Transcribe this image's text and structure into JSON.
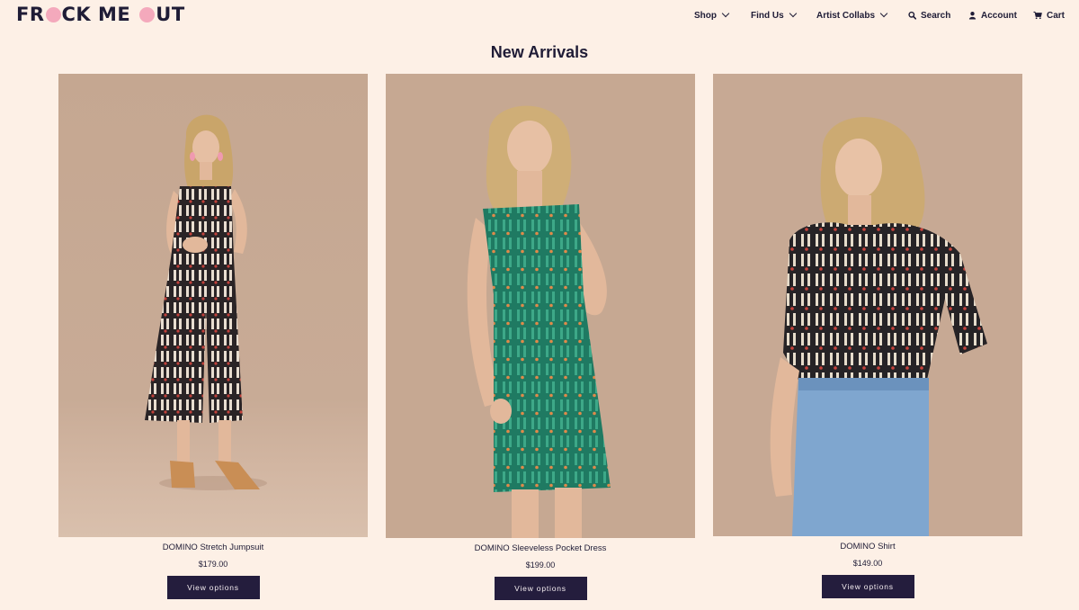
{
  "brand": {
    "logo_part1": "FR",
    "logo_part2": "CK ME",
    "logo_part3": "UT",
    "logo_accent": "#f4a9bc"
  },
  "nav": {
    "shop": "Shop",
    "find_us": "Find Us",
    "artist_collabs": "Artist Collabs",
    "search": "Search",
    "account": "Account",
    "cart": "Cart"
  },
  "page": {
    "title": "New Arrivals"
  },
  "products": [
    {
      "name": "DOMINO Stretch Jumpsuit",
      "price": "$179.00",
      "button": "View options"
    },
    {
      "name": "DOMINO Sleeveless Pocket Dress",
      "price": "$199.00",
      "button": "View options"
    },
    {
      "name": "DOMINO Shirt",
      "price": "$149.00",
      "button": "View options"
    }
  ],
  "colors": {
    "background": "#fdf0e6",
    "text": "#1f1c36",
    "button": "#241d3d"
  }
}
